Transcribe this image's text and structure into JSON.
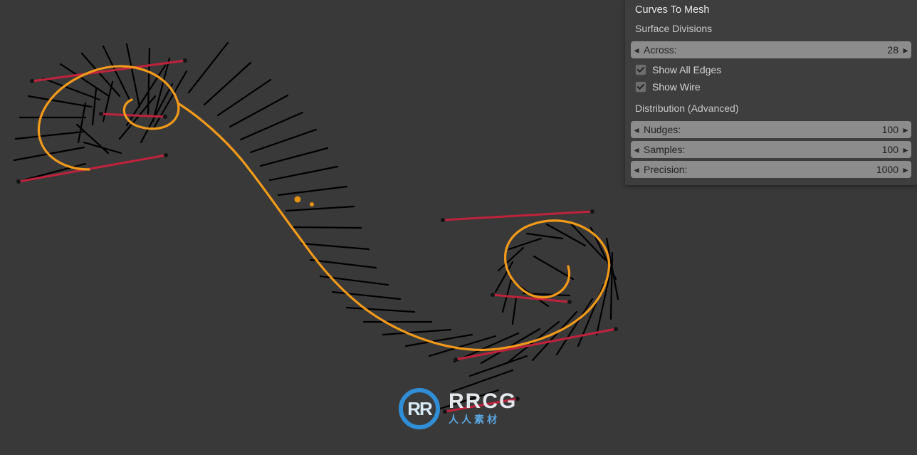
{
  "panel": {
    "heading": "Curves To Mesh",
    "surface_divisions_label": "Surface Divisions",
    "across_label": "Across:",
    "across_value": "28",
    "show_all_edges_label": "Show All Edges",
    "show_all_edges_checked": true,
    "show_wire_label": "Show Wire",
    "show_wire_checked": true,
    "distribution_label": "Distribution (Advanced)",
    "nudges_label": "Nudges:",
    "nudges_value": "100",
    "samples_label": "Samples:",
    "samples_value": "100",
    "precision_label": "Precision:",
    "precision_value": "1000"
  },
  "watermark": {
    "badge": "RR",
    "title": "RRCG",
    "sub": "人人素材"
  },
  "icons": {
    "left_arrow": "◂",
    "right_arrow": "▸"
  }
}
